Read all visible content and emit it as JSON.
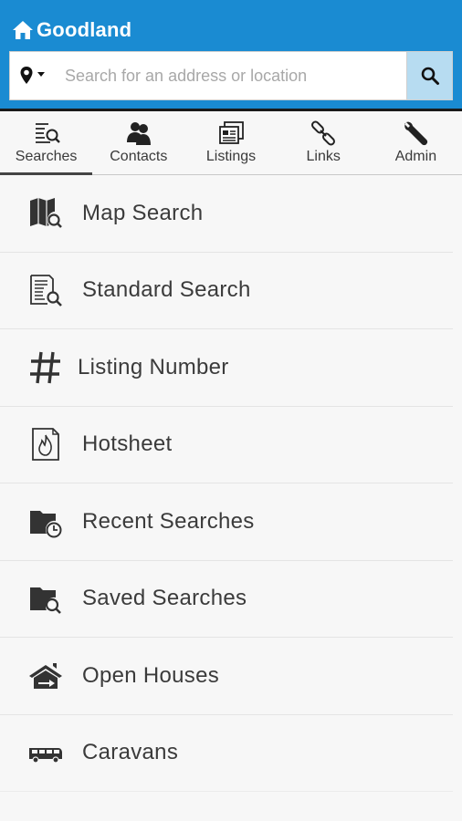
{
  "app": {
    "brand": "Goodland"
  },
  "search": {
    "placeholder": "Search for an address or location"
  },
  "tabs": [
    {
      "label": "Searches",
      "icon": "search-list-icon"
    },
    {
      "label": "Contacts",
      "icon": "contacts-icon"
    },
    {
      "label": "Listings",
      "icon": "listings-icon"
    },
    {
      "label": "Links",
      "icon": "link-icon"
    },
    {
      "label": "Admin",
      "icon": "wrench-icon"
    }
  ],
  "menu": [
    {
      "label": "Map Search",
      "icon": "map-search-icon"
    },
    {
      "label": "Standard Search",
      "icon": "document-search-icon"
    },
    {
      "label": "Listing Number",
      "icon": "hash-icon"
    },
    {
      "label": "Hotsheet",
      "icon": "fire-document-icon"
    },
    {
      "label": "Recent Searches",
      "icon": "folder-clock-icon"
    },
    {
      "label": "Saved Searches",
      "icon": "folder-search-icon"
    },
    {
      "label": "Open Houses",
      "icon": "open-house-icon"
    },
    {
      "label": "Caravans",
      "icon": "bus-icon"
    }
  ],
  "colors": {
    "header": "#1a8bd2",
    "search_button": "#b7dcf1",
    "text": "#3b3b3b"
  }
}
